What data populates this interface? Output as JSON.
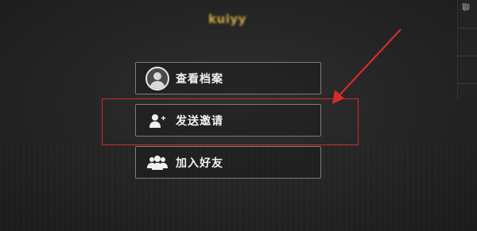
{
  "profile": {
    "username": "kuiyy"
  },
  "menu": {
    "view_profile": "查看档案",
    "send_invite": "发送邀请",
    "add_friend": "加入好友"
  },
  "side_panel": {
    "label": "聊"
  },
  "icons": {
    "view_profile": "avatar-icon",
    "send_invite": "user-plus-icon",
    "add_friend": "users-group-icon"
  },
  "colors": {
    "username": "#d1a93f",
    "annotation": "#d62b2b",
    "button_border": "#7d7d7d"
  }
}
